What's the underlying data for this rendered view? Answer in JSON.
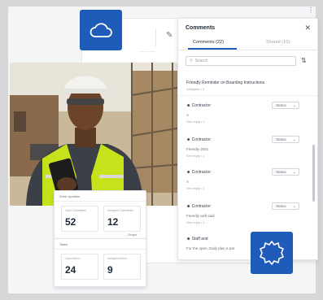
{
  "panel": {
    "title": "Comments",
    "tabs": [
      {
        "label": "Comments (22)",
        "active": true
      },
      {
        "label": "Shared (10)",
        "active": false
      }
    ],
    "search_placeholder": "Search",
    "threads": [
      {
        "text": "Friendly Reminder on Boarding Instructions",
        "meta": "Assignee • 2"
      },
      {
        "author": "Contractor",
        "status": "Status",
        "note": "A",
        "meta": "See reply • 1"
      },
      {
        "author": "Contractor",
        "status": "Status",
        "note": "Friendly 2021",
        "meta": "See reply • 1"
      },
      {
        "author": "Contractor",
        "status": "Status",
        "note": "A",
        "meta": "See reply • 1"
      },
      {
        "author": "Contractor",
        "status": "Status",
        "note": "Friendly well said",
        "meta": "See reply • 1"
      },
      {
        "author": "Staff and",
        "status": "",
        "note": "For the open, Daily plan a pat",
        "meta": ""
      }
    ]
  },
  "cards": [
    {
      "header": "Work Updates",
      "metrics": [
        {
          "label": "Open Submittals",
          "value": "52"
        },
        {
          "label": "Assigned Submittals",
          "value": "12"
        }
      ]
    },
    {
      "header": "Tasks",
      "metrics": [
        {
          "label": "Open Items",
          "value": "24"
        },
        {
          "label": "Assigned Items",
          "value": "9"
        }
      ]
    }
  ],
  "tile_tag": "Graph",
  "icons": {
    "cloud": "cloud-icon",
    "gear": "gear-icon",
    "close": "close-icon",
    "sort": "sort-icon"
  },
  "colors": {
    "brand": "#1f5bb8",
    "vest": "#c6e21a",
    "hardhat": "#f2f2ee"
  }
}
